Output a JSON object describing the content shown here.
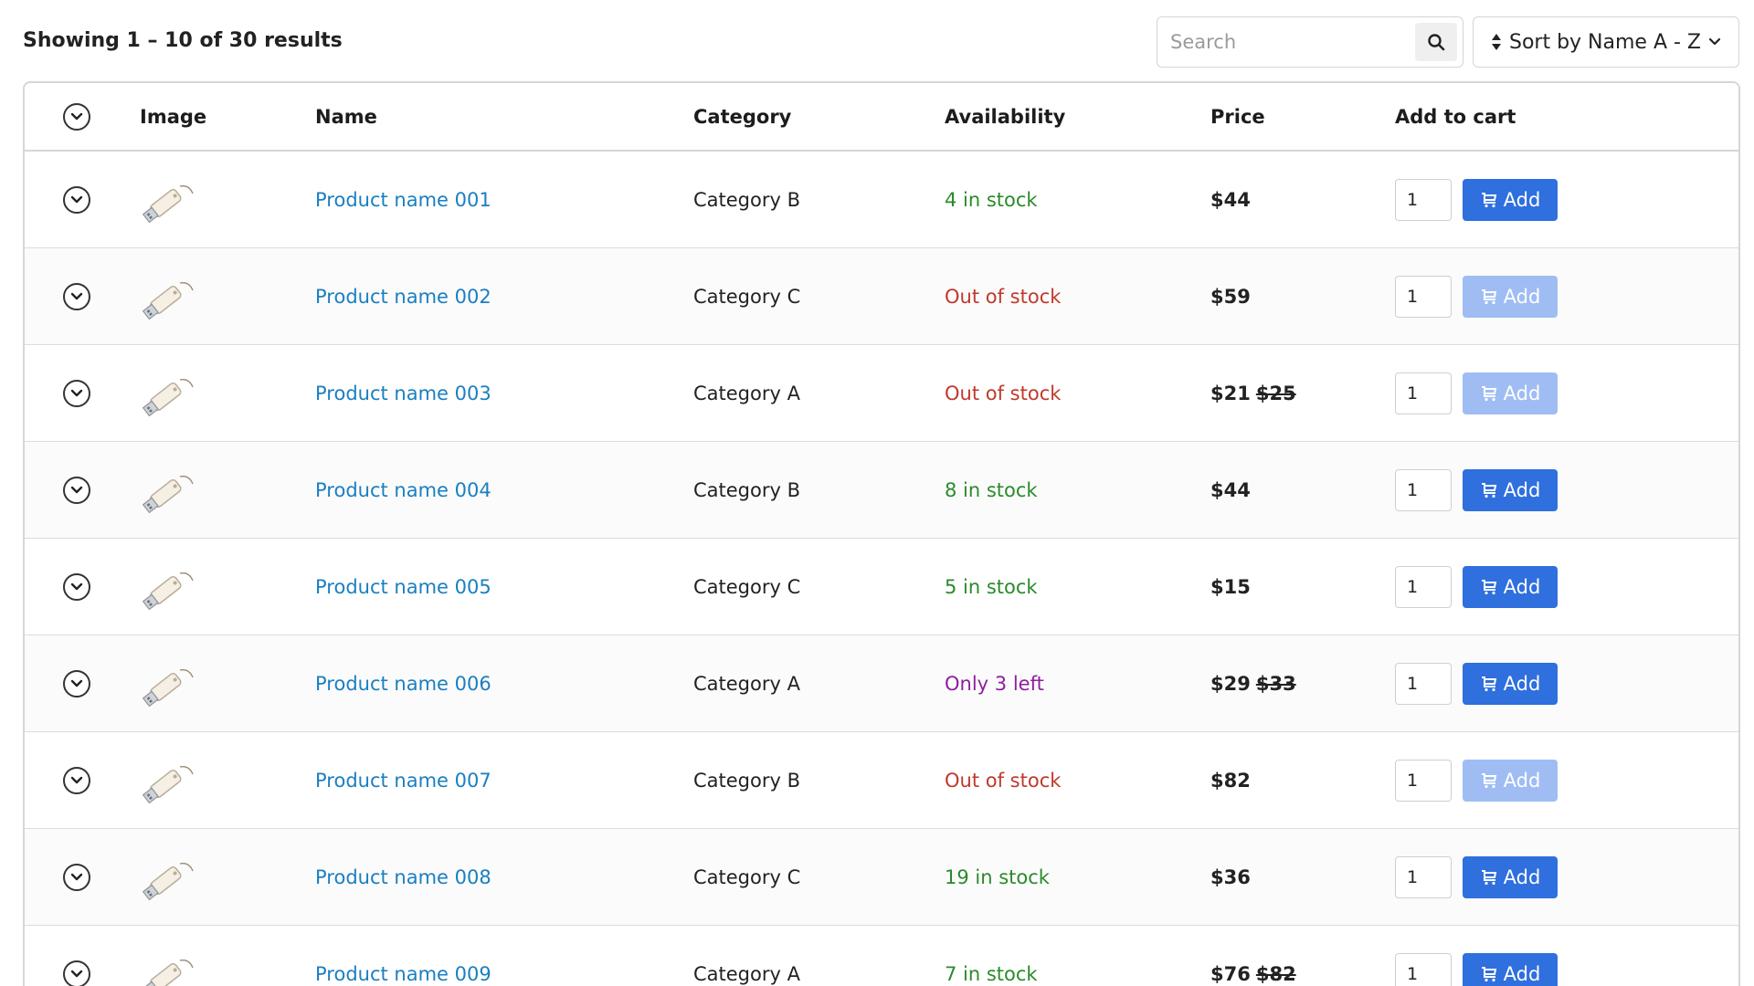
{
  "summary": "Showing 1 – 10 of 30 results",
  "search": {
    "placeholder": "Search",
    "icon": "search-icon"
  },
  "sort": {
    "label": "Sort by Name A - Z",
    "icon": "sort-icon",
    "chevron": "chevron-down-icon"
  },
  "columns": {
    "image": "Image",
    "name": "Name",
    "category": "Category",
    "availability": "Availability",
    "price": "Price",
    "cart": "Add to cart"
  },
  "add_label": "Add",
  "colors": {
    "in_stock": "#2b8a2b",
    "out_of_stock": "#c0392b",
    "low_stock": "#8e1f9e",
    "add_button": "#2f6fde",
    "add_button_disabled": "#9fbdf3",
    "link": "#1a7fc1"
  },
  "rows": [
    {
      "name": "Product name 001",
      "category": "Category B",
      "availability": "4 in stock",
      "status": "in",
      "price": "$44",
      "old_price": "",
      "qty": "1",
      "enabled": true
    },
    {
      "name": "Product name 002",
      "category": "Category C",
      "availability": "Out of stock",
      "status": "out",
      "price": "$59",
      "old_price": "",
      "qty": "1",
      "enabled": false
    },
    {
      "name": "Product name 003",
      "category": "Category A",
      "availability": "Out of stock",
      "status": "out",
      "price": "$21",
      "old_price": "$25",
      "qty": "1",
      "enabled": false
    },
    {
      "name": "Product name 004",
      "category": "Category B",
      "availability": "8 in stock",
      "status": "in",
      "price": "$44",
      "old_price": "",
      "qty": "1",
      "enabled": true
    },
    {
      "name": "Product name 005",
      "category": "Category C",
      "availability": "5 in stock",
      "status": "in",
      "price": "$15",
      "old_price": "",
      "qty": "1",
      "enabled": true
    },
    {
      "name": "Product name 006",
      "category": "Category A",
      "availability": "Only 3 left",
      "status": "low",
      "price": "$29",
      "old_price": "$33",
      "qty": "1",
      "enabled": true
    },
    {
      "name": "Product name 007",
      "category": "Category B",
      "availability": "Out of stock",
      "status": "out",
      "price": "$82",
      "old_price": "",
      "qty": "1",
      "enabled": false
    },
    {
      "name": "Product name 008",
      "category": "Category C",
      "availability": "19 in stock",
      "status": "in",
      "price": "$36",
      "old_price": "",
      "qty": "1",
      "enabled": true
    },
    {
      "name": "Product name 009",
      "category": "Category A",
      "availability": "7 in stock",
      "status": "in",
      "price": "$76",
      "old_price": "$82",
      "qty": "1",
      "enabled": true
    }
  ]
}
